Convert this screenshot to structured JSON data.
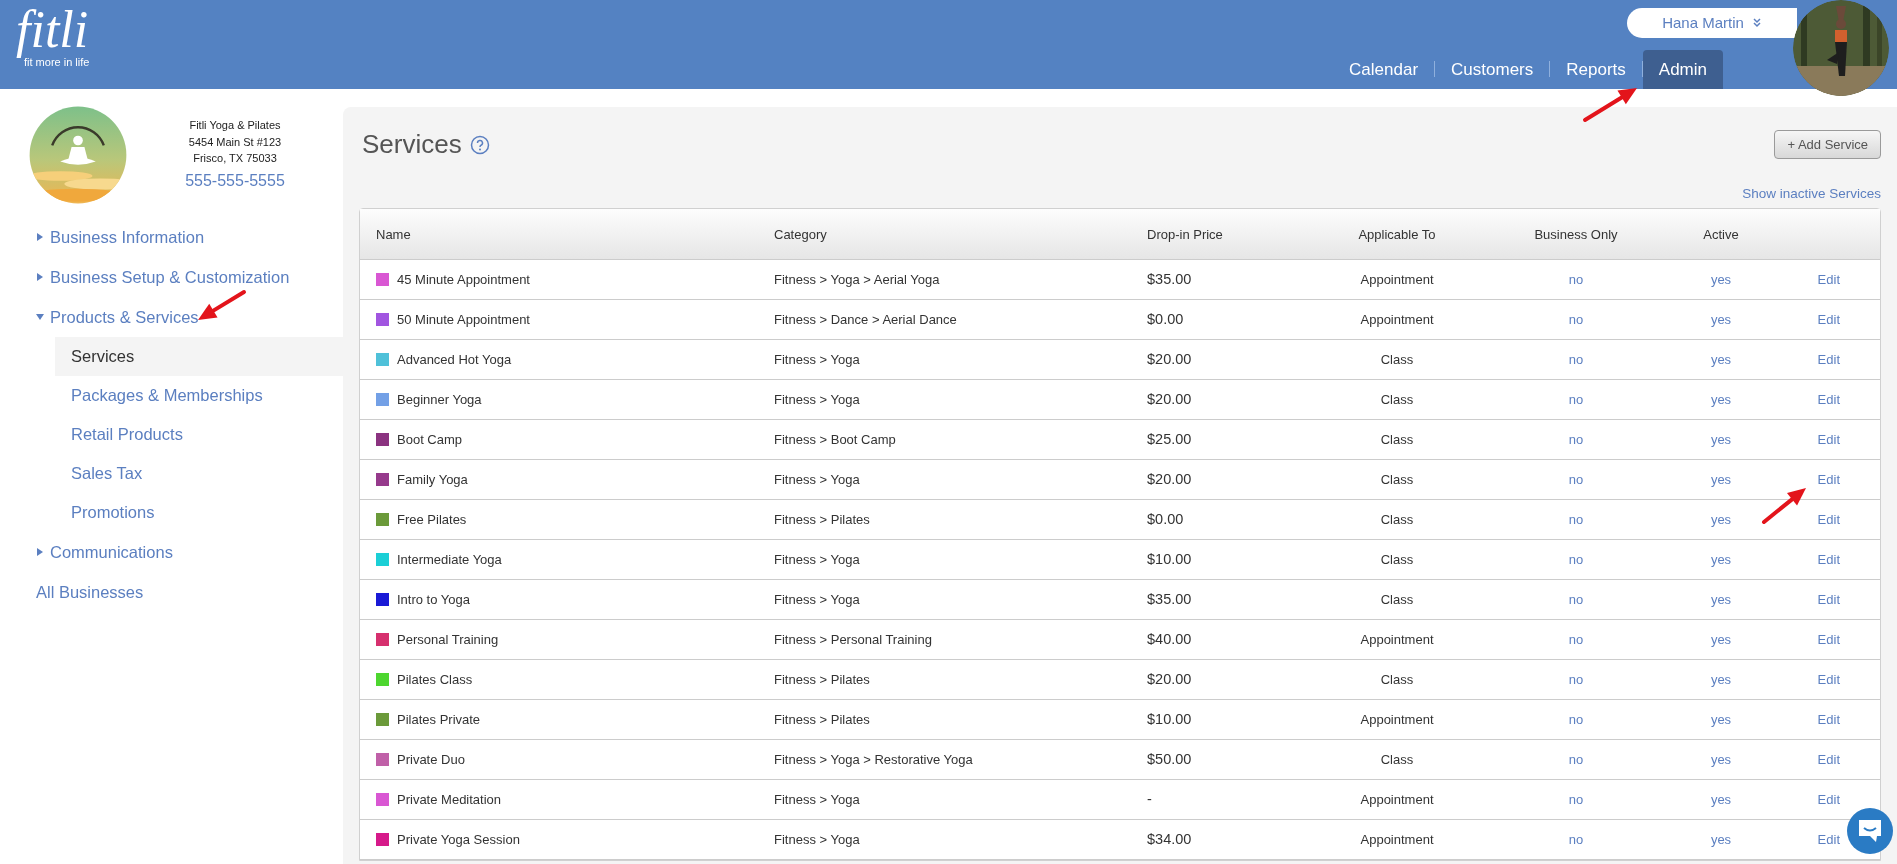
{
  "header": {
    "logo": "fitli",
    "tagline": "fit more in life",
    "user_menu": "Hana Martin",
    "nav": [
      {
        "label": "Calendar",
        "selected": false
      },
      {
        "label": "Customers",
        "selected": false
      },
      {
        "label": "Reports",
        "selected": false
      },
      {
        "label": "Admin",
        "selected": true
      }
    ]
  },
  "business": {
    "name": "Fitli Yoga & Pilates",
    "address": "5454 Main St #123",
    "city": "Frisco, TX 75033",
    "phone": "555-555-5555"
  },
  "sidebar": {
    "items": [
      {
        "label": "Business Information",
        "expanded": false
      },
      {
        "label": "Business Setup & Customization",
        "expanded": false
      },
      {
        "label": "Products & Services",
        "expanded": true,
        "children": [
          {
            "label": "Services",
            "selected": true
          },
          {
            "label": "Packages & Memberships",
            "selected": false
          },
          {
            "label": "Retail Products",
            "selected": false
          },
          {
            "label": "Sales Tax",
            "selected": false
          },
          {
            "label": "Promotions",
            "selected": false
          }
        ]
      },
      {
        "label": "Communications",
        "expanded": false
      },
      {
        "label": "All Businesses"
      }
    ]
  },
  "page": {
    "title": "Services",
    "add_button": "+ Add Service",
    "show_inactive": "Show inactive Services"
  },
  "table": {
    "columns": [
      "Name",
      "Category",
      "Drop-in Price",
      "Applicable To",
      "Business Only",
      "Active"
    ],
    "rows": [
      {
        "name": "45 Minute Appointment",
        "color": "#d957d3",
        "category": "Fitness > Yoga > Aerial Yoga",
        "price": "$35.00",
        "applicable": "Appointment",
        "business_only": "no",
        "active": "yes",
        "action": "Edit"
      },
      {
        "name": "50 Minute Appointment",
        "color": "#a155e0",
        "category": "Fitness > Dance > Aerial Dance",
        "price": "$0.00",
        "applicable": "Appointment",
        "business_only": "no",
        "active": "yes",
        "action": "Edit"
      },
      {
        "name": "Advanced Hot Yoga",
        "color": "#4fc1d9",
        "category": "Fitness > Yoga",
        "price": "$20.00",
        "applicable": "Class",
        "business_only": "no",
        "active": "yes",
        "action": "Edit"
      },
      {
        "name": "Beginner Yoga",
        "color": "#73a0e6",
        "category": "Fitness > Yoga",
        "price": "$20.00",
        "applicable": "Class",
        "business_only": "no",
        "active": "yes",
        "action": "Edit"
      },
      {
        "name": "Boot Camp",
        "color": "#8b3380",
        "category": "Fitness > Boot Camp",
        "price": "$25.00",
        "applicable": "Class",
        "business_only": "no",
        "active": "yes",
        "action": "Edit"
      },
      {
        "name": "Family Yoga",
        "color": "#963a8c",
        "category": "Fitness > Yoga",
        "price": "$20.00",
        "applicable": "Class",
        "business_only": "no",
        "active": "yes",
        "action": "Edit"
      },
      {
        "name": "Free Pilates",
        "color": "#6b9a3a",
        "category": "Fitness > Pilates",
        "price": "$0.00",
        "applicable": "Class",
        "business_only": "no",
        "active": "yes",
        "action": "Edit"
      },
      {
        "name": "Intermediate Yoga",
        "color": "#1bcfd6",
        "category": "Fitness > Yoga",
        "price": "$10.00",
        "applicable": "Class",
        "business_only": "no",
        "active": "yes",
        "action": "Edit"
      },
      {
        "name": "Intro to Yoga",
        "color": "#1a1ad6",
        "category": "Fitness > Yoga",
        "price": "$35.00",
        "applicable": "Class",
        "business_only": "no",
        "active": "yes",
        "action": "Edit"
      },
      {
        "name": "Personal Training",
        "color": "#d6306e",
        "category": "Fitness > Personal Training",
        "price": "$40.00",
        "applicable": "Appointment",
        "business_only": "no",
        "active": "yes",
        "action": "Edit"
      },
      {
        "name": "Pilates Class",
        "color": "#4dd62f",
        "category": "Fitness > Pilates",
        "price": "$20.00",
        "applicable": "Class",
        "business_only": "no",
        "active": "yes",
        "action": "Edit"
      },
      {
        "name": "Pilates Private",
        "color": "#6b9a3a",
        "category": "Fitness > Pilates",
        "price": "$10.00",
        "applicable": "Appointment",
        "business_only": "no",
        "active": "yes",
        "action": "Edit"
      },
      {
        "name": "Private Duo",
        "color": "#c060a8",
        "category": "Fitness > Yoga > Restorative Yoga",
        "price": "$50.00",
        "applicable": "Class",
        "business_only": "no",
        "active": "yes",
        "action": "Edit"
      },
      {
        "name": "Private Meditation",
        "color": "#d957d3",
        "category": "Fitness > Yoga",
        "price": "-",
        "applicable": "Appointment",
        "business_only": "no",
        "active": "yes",
        "action": "Edit"
      },
      {
        "name": "Private Yoga Session",
        "color": "#d61a8a",
        "category": "Fitness > Yoga",
        "price": "$34.00",
        "applicable": "Appointment",
        "business_only": "no",
        "active": "yes",
        "action": "Edit"
      }
    ]
  }
}
